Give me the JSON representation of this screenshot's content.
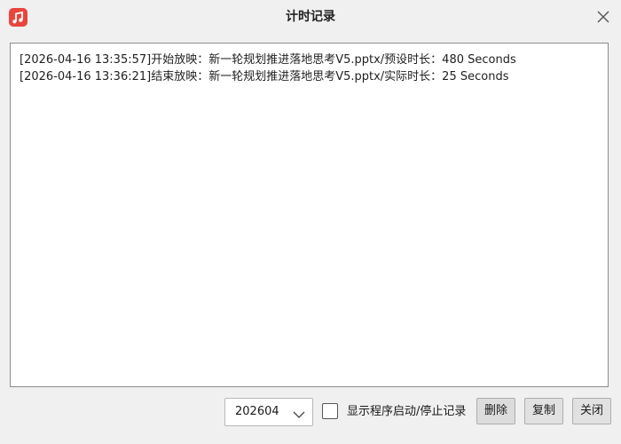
{
  "window": {
    "title": "计时记录",
    "app_icon": "music-note-icon",
    "close_icon": "close-icon"
  },
  "log": {
    "lines": [
      "[2026-04-16 13:35:57]开始放映：新一轮规划推进落地思考V5.pptx/预设时长：480 Seconds",
      "[2026-04-16 13:36:21]结束放映：新一轮规划推进落地思考V5.pptx/实际时长：25 Seconds"
    ]
  },
  "footer": {
    "month_value": "202604",
    "show_startup_label": "显示程序启动/停止记录",
    "show_startup_checked": false,
    "delete_label": "删除",
    "copy_label": "复制",
    "close_label": "关闭"
  },
  "colors": {
    "accent": "#e8453c",
    "background": "#f0f0f0"
  }
}
